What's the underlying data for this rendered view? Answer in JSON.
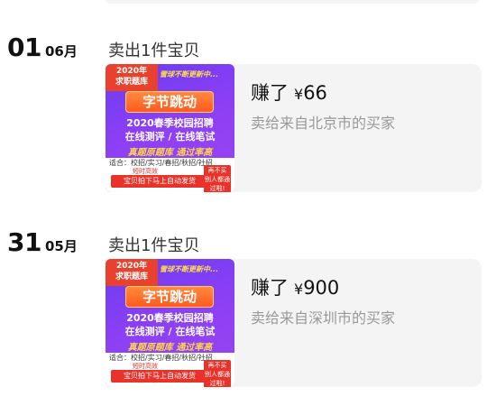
{
  "sales": [
    {
      "day": "01",
      "month": "06月",
      "title": "卖出1件宝贝",
      "earn_label": "赚了",
      "currency": "¥",
      "amount": "66",
      "buyer": "卖给来自北京市的买家"
    },
    {
      "day": "31",
      "month": "05月",
      "title": "卖出1件宝贝",
      "earn_label": "赚了",
      "currency": "¥",
      "amount": "900",
      "buyer": "卖给来自深圳市的买家"
    }
  ],
  "thumbnail": {
    "corner_year": "2020年",
    "corner_text": "求职题库",
    "slogan": "雪球不断更新中...",
    "company": "字节跳动",
    "line1": "2020春季校园招聘",
    "line2": "在线测评 / 在线笔试",
    "tags": "真题原题库   通过率高",
    "fit": "适合：校招/实习/春招/秋招/社招",
    "short": "短时高效",
    "red_bar": "宝贝拍下马上自动发货",
    "refund": "再不买 别人都通过啦!"
  },
  "colors": {
    "card_bg": "#f4f4f4",
    "text_primary": "#111111",
    "text_secondary": "#999999",
    "thumb_purple": "#7a3ff0",
    "thumb_red": "#e8422e"
  }
}
